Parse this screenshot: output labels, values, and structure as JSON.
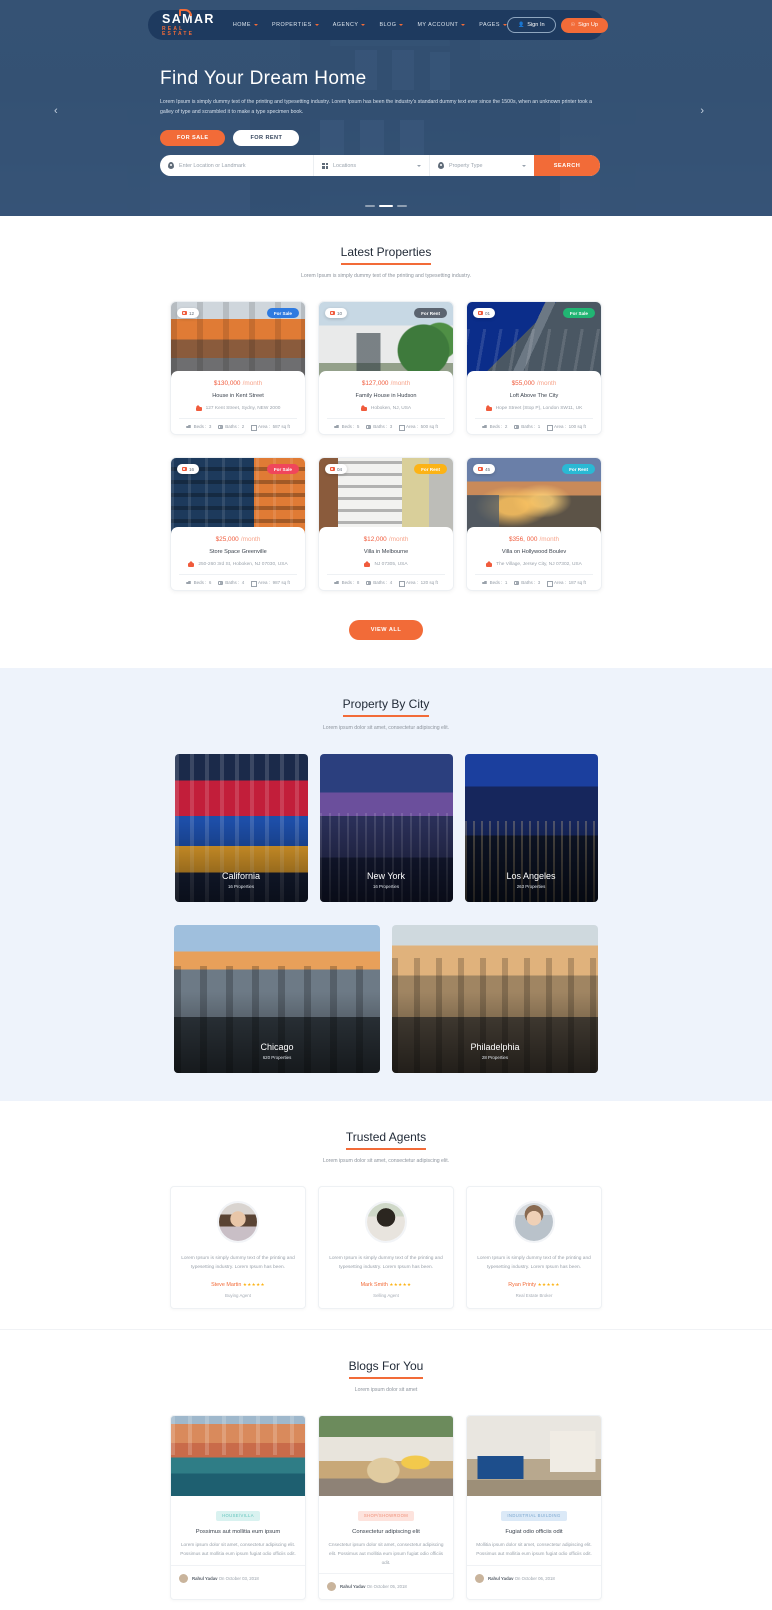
{
  "brand": {
    "name": "SAMAR",
    "tagline": "REAL ESTATE"
  },
  "nav": {
    "links": [
      {
        "label": "HOME",
        "caret": true
      },
      {
        "label": "PROPERTIES",
        "caret": true
      },
      {
        "label": "AGENCY",
        "caret": true
      },
      {
        "label": "BLOG",
        "caret": true
      },
      {
        "label": "MY ACCOUNT",
        "caret": true
      },
      {
        "label": "PAGES",
        "caret": true
      }
    ],
    "signin": "Sign In",
    "signup": "Sign Up"
  },
  "hero": {
    "title": "Find Your Dream Home",
    "subtitle": "Lorem Ipsum is simply dummy text of the printing and typesetting industry. Lorem Ipsum has been the industry's standard dummy text ever since the 1500s, when an unknown printer took a galley of type and scrambled it to make a type specimen book.",
    "tab_sale": "FOR SALE",
    "tab_rent": "FOR RENT",
    "search": {
      "location_placeholder": "Enter Location or Landmark",
      "locations_label": "Locations",
      "property_type_label": "Property Type",
      "button": "SEARCH"
    }
  },
  "latest": {
    "title": "Latest Properties",
    "subtitle": "Lorem Ipsum is simply dummy text of the printing and typesetting industry.",
    "view_all": "VIEW ALL",
    "feature_labels": {
      "beds": "Beds :",
      "baths": "Baths :",
      "area": "Area :"
    },
    "properties": [
      {
        "photo_count": "12",
        "status": "For Sale",
        "status_color": "#2e7ae0",
        "price": "$130,000",
        "period": "/month",
        "title": "House in Kent Street",
        "address": "127 Kent Street, Sydny, NEW 2000",
        "beds": "3",
        "baths": "2",
        "area": "587 sq ft",
        "img": "townhouses-orange"
      },
      {
        "photo_count": "10",
        "status": "For Rent",
        "status_color": "#5b6470",
        "price": "$127,000",
        "period": "/month",
        "title": "Family House in Hudson",
        "address": "Hoboken, NJ, USA",
        "beds": "5",
        "baths": "3",
        "area": "500 sq ft",
        "img": "modern-white-villa"
      },
      {
        "photo_count": "01",
        "status": "For Sale",
        "status_color": "#21b573",
        "price": "$55,000",
        "period": "/month",
        "title": "Loft Above The City",
        "address": "Hope Street (Stop P), London SW11, UK",
        "beds": "2",
        "baths": "1",
        "area": "100 sq ft",
        "img": "dark-loft-blue-sky"
      },
      {
        "photo_count": "16",
        "status": "For Sale",
        "status_color": "#f0465b",
        "price": "$25,000",
        "period": "/month",
        "title": "Store Space Greenville",
        "address": "250-260 3rd St, Hoboken, NJ 07030, USA",
        "beds": "6",
        "baths": "4",
        "area": "987 sq ft",
        "img": "blue-orange-apartments"
      },
      {
        "photo_count": "04",
        "status": "For Rent",
        "status_color": "#fcb316",
        "price": "$12,000",
        "period": "/month",
        "title": "Villa in Melbourne",
        "address": "NJ 07305, USA",
        "beds": "8",
        "baths": "4",
        "area": "120 sq ft",
        "img": "white-tower-block"
      },
      {
        "photo_count": "45",
        "status": "For Rent",
        "status_color": "#2ab9d4",
        "price": "$356, 000",
        "period": "/month",
        "title": "Villa on Hollywood Boulev",
        "address": "The Village, Jersey City, NJ 07302, USA",
        "beds": "1",
        "baths": "3",
        "area": "187 sq ft",
        "img": "dusk-house-lights"
      }
    ]
  },
  "city": {
    "title": "Property By City",
    "subtitle": "Lorem ipsum dolor sit amet, consectetur adipiscing elit.",
    "items": [
      {
        "name": "California",
        "count": "16 Properties",
        "img": "times-square"
      },
      {
        "name": "New York",
        "count": "16 Properties",
        "img": "ny-skyline-purple"
      },
      {
        "name": "Los Angeles",
        "count": "263 Properties",
        "img": "la-night-blue"
      },
      {
        "name": "Chicago",
        "count": "620 Properties",
        "img": "chicago-sunset"
      },
      {
        "name": "Philadelphia",
        "count": "28 Properties",
        "img": "philadelphia-golden"
      }
    ]
  },
  "agents": {
    "title": "Trusted Agents",
    "subtitle": "Lorem ipsum dolor sit amet, consectetur adipiscing elit.",
    "items": [
      {
        "text": "Lorem Ipsum is simply dummy text of the printing and typesetting industry. Lorem Ipsum has been.",
        "name": "Steve Martin",
        "rating": "★★★★★",
        "role": "Buying Agent",
        "img": "woman-brown-hair"
      },
      {
        "text": "Lorem Ipsum is simply dummy text of the printing and typesetting industry. Lorem Ipsum has been.",
        "name": "Mark Smith",
        "rating": "★★★★★",
        "role": "Selling Agent",
        "img": "woman-dark-hair"
      },
      {
        "text": "Lorem Ipsum is simply dummy text of the printing and typesetting industry. Lorem Ipsum has been.",
        "name": "Ryan Printy",
        "rating": "★★★★★",
        "role": "Real Estate Broker",
        "img": "woman-short-hair"
      }
    ]
  },
  "blogs": {
    "title": "Blogs For You",
    "subtitle": "Lorem ipsum dolor sit amet",
    "items": [
      {
        "tag": "HOUSE/VILLA",
        "tag_bg": "#d9f2f0",
        "tag_color": "#5fc3bb",
        "title": "Possimus aut mollitia eum ipsum",
        "desc": "Lorem ipsum dolor sit amet, consectetur adipiscing elit. Possimus aut mollitia eum ipsum fugiat odio officiis odit.",
        "author": "Rahul Yadav",
        "meta": "On October 03, 2018",
        "img": "venice-canal"
      },
      {
        "tag": "SHOP/SHOWROOM",
        "tag_bg": "#fde3dd",
        "tag_color": "#f08e76",
        "title": "Consectetur adipiscing elit",
        "desc": "Cnsectetur ipsum dolor sit amet, consectetur adipiscing elit. Possimus aut mollitia eum ipsum fugiat odio officiis odit.",
        "author": "Rahul Yadav",
        "meta": "On October 05, 2018",
        "img": "modern-lounge"
      },
      {
        "tag": "INDUSTRIAL BUILDING",
        "tag_bg": "#dbe9f7",
        "tag_color": "#7aa6cf",
        "title": "Fugiat odio officiis odit",
        "desc": "Mollitia ipsum dolor sit amet, consectetur adipiscing elit. Possimus aut mollitia eum ipsum fugiat odio officiis odit.",
        "author": "Rahul Yadav",
        "meta": "On October 06, 2018",
        "img": "living-room-blue-sofa"
      }
    ]
  },
  "carousel": {
    "prev": "‹",
    "next": "›"
  }
}
